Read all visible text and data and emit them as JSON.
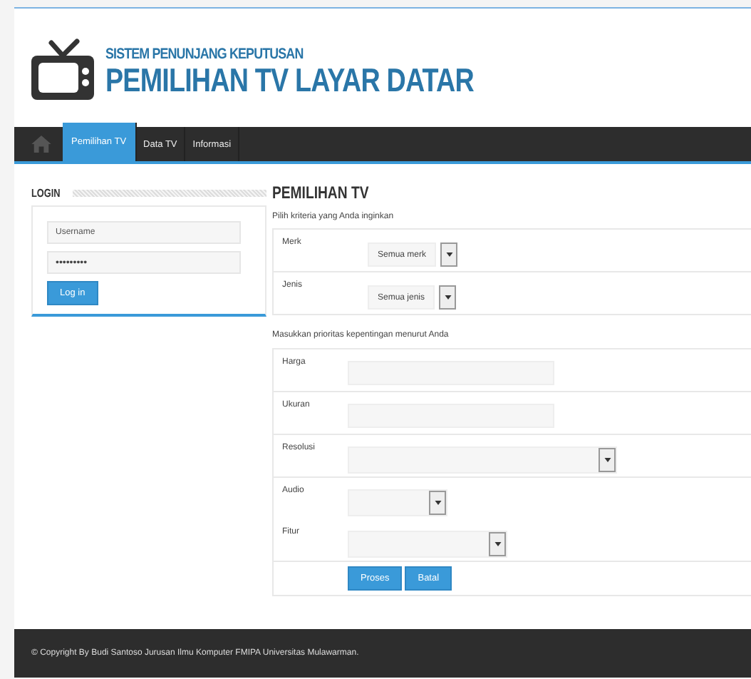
{
  "header": {
    "subtitle": "SISTEM PENUNJANG KEPUTUSAN",
    "title": "PEMILIHAN TV LAYAR DATAR"
  },
  "nav": {
    "items": [
      {
        "label": "Pemilihan TV",
        "selected": true
      },
      {
        "label": "Data TV",
        "selected": false
      },
      {
        "label": "Informasi",
        "selected": false
      }
    ]
  },
  "login": {
    "title": "LOGIN",
    "username_placeholder": "Username",
    "password_value": "•••••••••",
    "button": "Log in"
  },
  "main": {
    "title": "PEMILIHAN TV",
    "criteria_hint": "Pilih kriteria yang Anda inginkan",
    "criteria": [
      {
        "label": "Merk",
        "value": "Semua merk"
      },
      {
        "label": "Jenis",
        "value": "Semua jenis"
      }
    ],
    "priority_hint": "Masukkan prioritas kepentingan menurut Anda",
    "priorities": [
      {
        "label": "Harga",
        "kind": "text"
      },
      {
        "label": "Ukuran",
        "kind": "text"
      },
      {
        "label": "Resolusi",
        "kind": "select"
      },
      {
        "label": "Audio",
        "kind": "select"
      },
      {
        "label": "Fitur",
        "kind": "select"
      }
    ],
    "buttons": [
      "Proses",
      "Batal"
    ]
  },
  "footer": {
    "text": "© Copyright By Budi Santoso Jurusan Ilmu Komputer FMIPA Universitas Mulawarman."
  }
}
